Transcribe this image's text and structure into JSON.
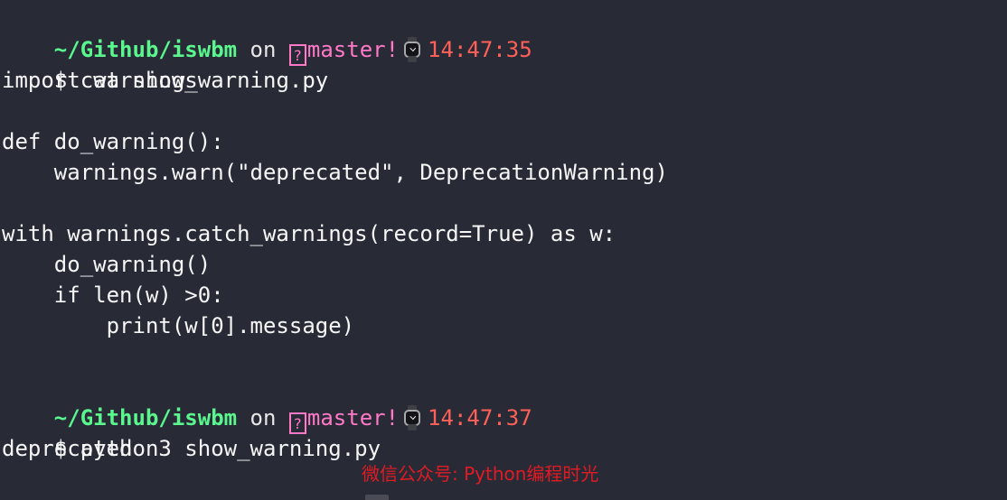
{
  "terminal": {
    "background_color": "#282a36",
    "foreground_color": "#f6f6f6",
    "prompt_path_color": "#5af78e",
    "branch_color": "#ff79c6",
    "time_color": "#ff6059",
    "watermark_color": "#e01b24"
  },
  "prompt1": {
    "path": "~/Github/iswbm",
    "on": " on ",
    "branch_glyph": "?",
    "branch": "master!",
    "clock_icon": "watch-icon",
    "time": "14:47:35"
  },
  "command1": {
    "sigil": "$ ",
    "text": "cat show_warning.py"
  },
  "file_content": [
    "import warnings",
    "",
    "def do_warning():",
    "    warnings.warn(\"deprecated\", DeprecationWarning)",
    "",
    "with warnings.catch_warnings(record=True) as w:",
    "    do_warning()",
    "    if len(w) >0:",
    "        print(w[0].message)"
  ],
  "prompt2": {
    "path": "~/Github/iswbm",
    "on": " on ",
    "branch_glyph": "?",
    "branch": "master!",
    "clock_icon": "watch-icon",
    "time": "14:47:37"
  },
  "command2": {
    "sigil": "$ ",
    "text": "python3 show_warning.py"
  },
  "output": [
    "deprecated"
  ],
  "watermark": {
    "text": "微信公众号: Python编程时光"
  }
}
